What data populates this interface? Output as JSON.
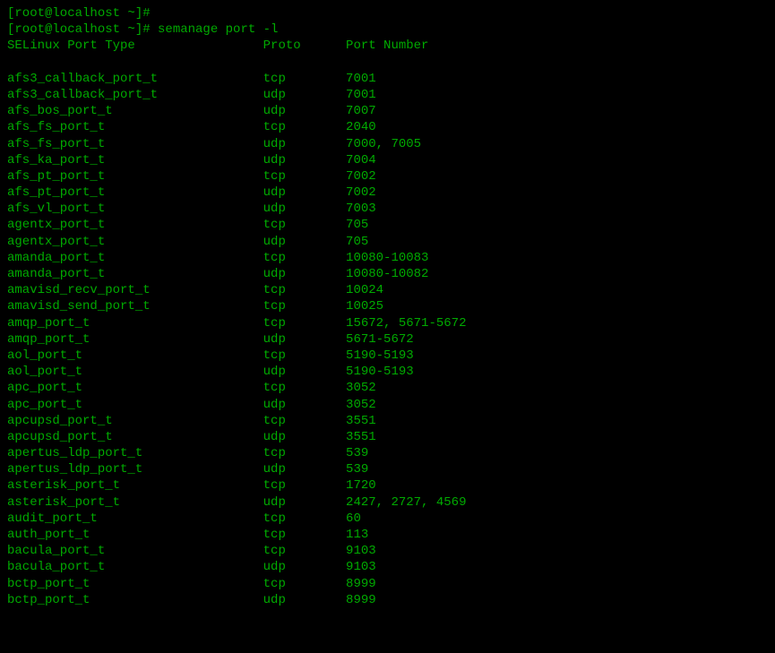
{
  "prompt1": "[root@localhost ~]#",
  "prompt2": "[root@localhost ~]# semanage port -l",
  "headers": {
    "type": "SELinux Port Type",
    "proto": "Proto",
    "ports": "Port Number"
  },
  "rows": [
    {
      "type": "afs3_callback_port_t",
      "proto": "tcp",
      "ports": "7001"
    },
    {
      "type": "afs3_callback_port_t",
      "proto": "udp",
      "ports": "7001"
    },
    {
      "type": "afs_bos_port_t",
      "proto": "udp",
      "ports": "7007"
    },
    {
      "type": "afs_fs_port_t",
      "proto": "tcp",
      "ports": "2040"
    },
    {
      "type": "afs_fs_port_t",
      "proto": "udp",
      "ports": "7000, 7005"
    },
    {
      "type": "afs_ka_port_t",
      "proto": "udp",
      "ports": "7004"
    },
    {
      "type": "afs_pt_port_t",
      "proto": "tcp",
      "ports": "7002"
    },
    {
      "type": "afs_pt_port_t",
      "proto": "udp",
      "ports": "7002"
    },
    {
      "type": "afs_vl_port_t",
      "proto": "udp",
      "ports": "7003"
    },
    {
      "type": "agentx_port_t",
      "proto": "tcp",
      "ports": "705"
    },
    {
      "type": "agentx_port_t",
      "proto": "udp",
      "ports": "705"
    },
    {
      "type": "amanda_port_t",
      "proto": "tcp",
      "ports": "10080-10083"
    },
    {
      "type": "amanda_port_t",
      "proto": "udp",
      "ports": "10080-10082"
    },
    {
      "type": "amavisd_recv_port_t",
      "proto": "tcp",
      "ports": "10024"
    },
    {
      "type": "amavisd_send_port_t",
      "proto": "tcp",
      "ports": "10025"
    },
    {
      "type": "amqp_port_t",
      "proto": "tcp",
      "ports": "15672, 5671-5672"
    },
    {
      "type": "amqp_port_t",
      "proto": "udp",
      "ports": "5671-5672"
    },
    {
      "type": "aol_port_t",
      "proto": "tcp",
      "ports": "5190-5193"
    },
    {
      "type": "aol_port_t",
      "proto": "udp",
      "ports": "5190-5193"
    },
    {
      "type": "apc_port_t",
      "proto": "tcp",
      "ports": "3052"
    },
    {
      "type": "apc_port_t",
      "proto": "udp",
      "ports": "3052"
    },
    {
      "type": "apcupsd_port_t",
      "proto": "tcp",
      "ports": "3551"
    },
    {
      "type": "apcupsd_port_t",
      "proto": "udp",
      "ports": "3551"
    },
    {
      "type": "apertus_ldp_port_t",
      "proto": "tcp",
      "ports": "539"
    },
    {
      "type": "apertus_ldp_port_t",
      "proto": "udp",
      "ports": "539"
    },
    {
      "type": "asterisk_port_t",
      "proto": "tcp",
      "ports": "1720"
    },
    {
      "type": "asterisk_port_t",
      "proto": "udp",
      "ports": "2427, 2727, 4569"
    },
    {
      "type": "audit_port_t",
      "proto": "tcp",
      "ports": "60"
    },
    {
      "type": "auth_port_t",
      "proto": "tcp",
      "ports": "113"
    },
    {
      "type": "bacula_port_t",
      "proto": "tcp",
      "ports": "9103"
    },
    {
      "type": "bacula_port_t",
      "proto": "udp",
      "ports": "9103"
    },
    {
      "type": "bctp_port_t",
      "proto": "tcp",
      "ports": "8999"
    },
    {
      "type": "bctp_port_t",
      "proto": "udp",
      "ports": "8999"
    }
  ]
}
